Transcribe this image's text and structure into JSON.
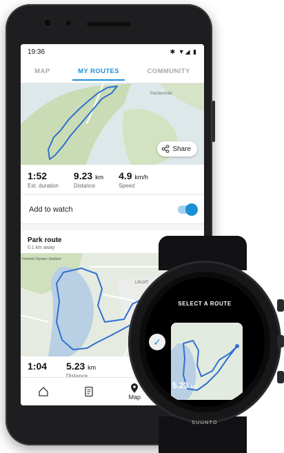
{
  "status": {
    "time": "19:36",
    "icons": "✱ ▼◢ ▮"
  },
  "tabs": [
    {
      "label": "MAP",
      "active": false
    },
    {
      "label": "MY ROUTES",
      "active": true
    },
    {
      "label": "COMMUNITY",
      "active": false
    }
  ],
  "colors": {
    "accent": "#1c8fd6",
    "route": "#2f6fd0",
    "water": "#b9cfe3",
    "park": "#c9dcb5"
  },
  "map1": {
    "place_label": "Pasilanmäki",
    "share_label": "Share",
    "share_icon": "share-icon"
  },
  "stats": [
    {
      "value": "1:52",
      "unit": "",
      "label": "Est. duration"
    },
    {
      "value": "9.23",
      "unit": "km",
      "label": "Distance"
    },
    {
      "value": "4.9",
      "unit": "km/h",
      "label": "Speed"
    }
  ],
  "add_to_watch": {
    "label": "Add to watch",
    "enabled": true
  },
  "route_card": {
    "title": "Park route",
    "subtitle": "0.1 km away",
    "icons": [
      "hiking-icon",
      "bicycle-icon"
    ],
    "map_labels": [
      "Helsinki Olympic Stadium",
      "LINJAT"
    ]
  },
  "stats2": [
    {
      "value": "1:04",
      "unit": "",
      "label": ""
    },
    {
      "value": "5.23",
      "unit": "km",
      "label": "Distance"
    }
  ],
  "bottom_nav": [
    {
      "label": "",
      "icon": "home-icon"
    },
    {
      "label": "",
      "icon": "diary-icon"
    },
    {
      "label": "Map",
      "icon": "map-pin-icon"
    }
  ],
  "watch": {
    "title": "SELECT A ROUTE",
    "distance_value": "5.23",
    "distance_unit": "km",
    "brand": "SUUNTO"
  }
}
